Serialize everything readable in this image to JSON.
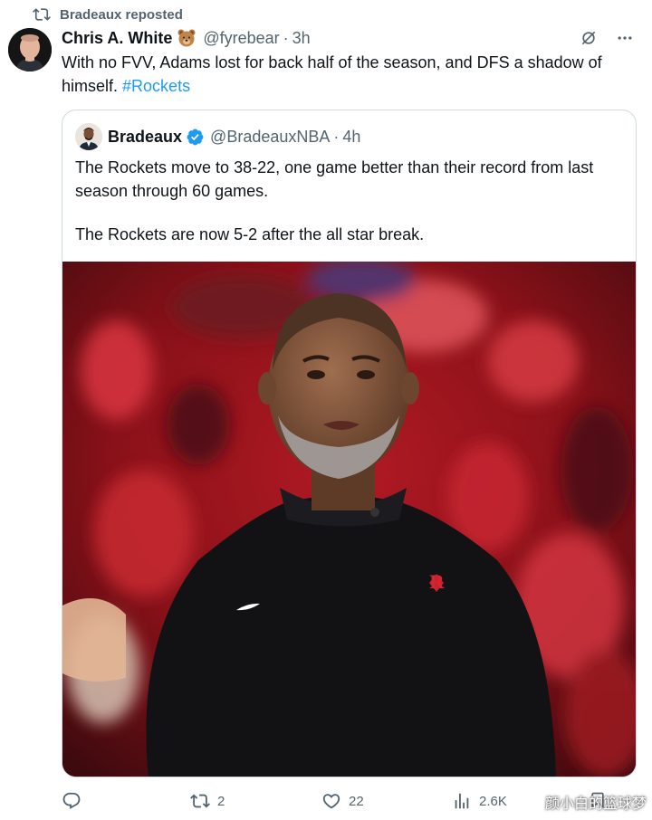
{
  "repost": {
    "label": "Bradeaux reposted",
    "icon": "repost-icon"
  },
  "tweet": {
    "author_name": "Chris A. White",
    "author_emoji": "bear-emoji",
    "handle": "@fyrebear",
    "separator": "·",
    "time": "3h",
    "text_main": "With no FVV, Adams lost for back half of the season, and DFS a shadow of himself. ",
    "hashtag": "#Rockets"
  },
  "quote": {
    "author_name": "Bradeaux",
    "verified": true,
    "handle": "@BradeauxNBA",
    "separator": "·",
    "time": "4h",
    "paragraph_1": "The Rockets move to 38-22, one game better than their record from last season through 60 games.",
    "paragraph_2": "The Rockets are now 5-2 after the all star break.",
    "image": "photo-of-coach-in-black-rockets-sweater"
  },
  "actions": {
    "replies": "",
    "reposts": "2",
    "likes": "22",
    "views": "2.6K"
  },
  "watermark": "颜小白的篮球梦",
  "colors": {
    "accent": "#1d9bf0",
    "secondary_text": "#536471",
    "border": "#cfd9de"
  }
}
